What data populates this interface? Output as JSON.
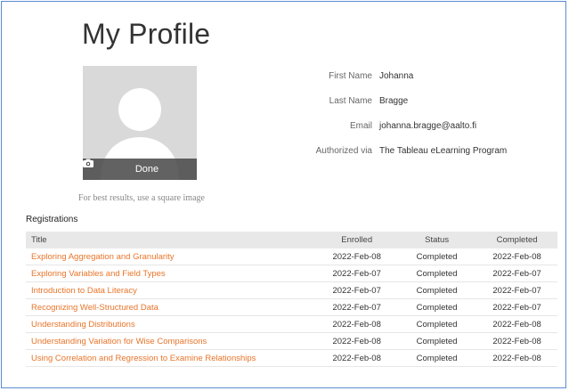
{
  "page": {
    "title": "My Profile"
  },
  "avatar": {
    "done_label": "Done",
    "hint": "For best results, use a square image"
  },
  "profile": {
    "fields": [
      {
        "label": "First Name",
        "value": "Johanna"
      },
      {
        "label": "Last Name",
        "value": "Bragge"
      },
      {
        "label": "Email",
        "value": "johanna.bragge@aalto.fi"
      },
      {
        "label": "Authorized via",
        "value": "The Tableau eLearning Program"
      }
    ]
  },
  "registrations": {
    "heading": "Registrations",
    "columns": [
      "Title",
      "Enrolled",
      "Status",
      "Completed"
    ],
    "rows": [
      {
        "title": "Exploring Aggregation and Granularity",
        "enrolled": "2022-Feb-08",
        "status": "Completed",
        "completed": "2022-Feb-08"
      },
      {
        "title": "Exploring Variables and Field Types",
        "enrolled": "2022-Feb-07",
        "status": "Completed",
        "completed": "2022-Feb-07"
      },
      {
        "title": "Introduction to Data Literacy",
        "enrolled": "2022-Feb-07",
        "status": "Completed",
        "completed": "2022-Feb-07"
      },
      {
        "title": "Recognizing Well-Structured Data",
        "enrolled": "2022-Feb-07",
        "status": "Completed",
        "completed": "2022-Feb-07"
      },
      {
        "title": "Understanding Distributions",
        "enrolled": "2022-Feb-08",
        "status": "Completed",
        "completed": "2022-Feb-08"
      },
      {
        "title": "Understanding Variation for Wise Comparisons",
        "enrolled": "2022-Feb-08",
        "status": "Completed",
        "completed": "2022-Feb-08"
      },
      {
        "title": "Using Correlation and Regression to Examine Relationships",
        "enrolled": "2022-Feb-08",
        "status": "Completed",
        "completed": "2022-Feb-08"
      }
    ]
  },
  "icons": {
    "camera": "camera-icon",
    "avatar": "user-silhouette-icon"
  },
  "colors": {
    "link": "#e8752a",
    "frame_border": "#5b8bd0",
    "header_bg": "#e8e8e8"
  }
}
